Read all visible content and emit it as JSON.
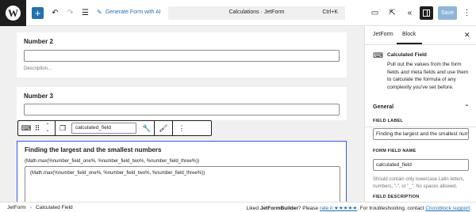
{
  "topbar": {
    "wp_logo": "W",
    "add_icon": "plus-icon",
    "generate_label": "Generate Form with AI",
    "doc_title": "Calculations · JetForm",
    "shortcut": "Ctrl+K",
    "save_label": "Save"
  },
  "canvas": {
    "number2_label": "Number 2",
    "number2_desc": "Description...",
    "number3_label": "Number 3",
    "field_name_value": "calculated_field",
    "calc_title": "Finding the largest and the smallest numbers",
    "calc_formula": "(Math.max(%number_field_one%, %number_field_two%, %number_field_three%))",
    "calc_box_text": "(Math.max(%number_field_one%, %number_field_two%, %number_field_three%))"
  },
  "sidebar": {
    "tab_form": "JetForm",
    "tab_block": "Block",
    "block_name": "Calculated Field",
    "block_desc": "Pull out the values from the form fields and meta fields and use them to calculate the formula of any complexity you've set before.",
    "panel_general": "General",
    "field_label_label": "FIELD LABEL",
    "field_label_value": "Finding the largest and the smallest num",
    "form_field_name_label": "FORM FIELD NAME",
    "form_field_name_value": "calculated_field",
    "name_help": "Should contain only lowercase Latin letters, numbers, \"-\", or \"_\". No spaces allowed.",
    "field_desc_label": "FIELD DESCRIPTION"
  },
  "statusbar": {
    "crumb_1": "JetForm",
    "crumb_2": "Calculated Field",
    "note_prefix": "Liked ",
    "note_brand": "JetFormBuilder",
    "note_mid": "? Please ",
    "note_rate": "rate it ★★★★★",
    "note_after": ". For troubleshooting, contact ",
    "note_support": "Crocoblock support",
    "note_end": "."
  }
}
